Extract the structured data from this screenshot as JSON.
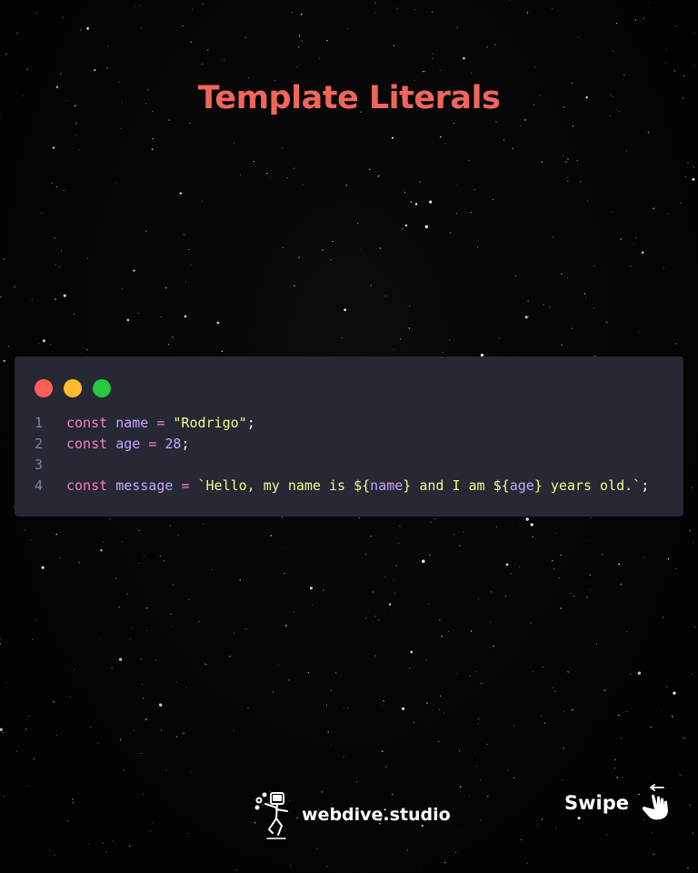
{
  "title": "Template Literals",
  "window": {
    "controls": [
      {
        "name": "close",
        "color": "#ff5f57"
      },
      {
        "name": "minimize",
        "color": "#febc2e"
      },
      {
        "name": "maximize",
        "color": "#28c840"
      }
    ]
  },
  "code": {
    "lines": [
      {
        "number": "1",
        "tokens": [
          {
            "t": "kw",
            "v": "const"
          },
          {
            "t": "punc",
            "v": " "
          },
          {
            "t": "var",
            "v": "name"
          },
          {
            "t": "punc",
            "v": " "
          },
          {
            "t": "op",
            "v": "="
          },
          {
            "t": "punc",
            "v": " "
          },
          {
            "t": "str",
            "v": "\"Rodrigo\""
          },
          {
            "t": "punc",
            "v": ";"
          }
        ]
      },
      {
        "number": "2",
        "tokens": [
          {
            "t": "kw",
            "v": "const"
          },
          {
            "t": "punc",
            "v": " "
          },
          {
            "t": "var",
            "v": "age"
          },
          {
            "t": "punc",
            "v": " "
          },
          {
            "t": "op",
            "v": "="
          },
          {
            "t": "punc",
            "v": " "
          },
          {
            "t": "num",
            "v": "28"
          },
          {
            "t": "punc",
            "v": ";"
          }
        ]
      },
      {
        "number": "3",
        "tokens": []
      },
      {
        "number": "4",
        "tokens": [
          {
            "t": "kw",
            "v": "const"
          },
          {
            "t": "punc",
            "v": " "
          },
          {
            "t": "var",
            "v": "message"
          },
          {
            "t": "punc",
            "v": " "
          },
          {
            "t": "op",
            "v": "="
          },
          {
            "t": "punc",
            "v": " "
          },
          {
            "t": "str",
            "v": "`Hello, my name is ${"
          },
          {
            "t": "var",
            "v": "name"
          },
          {
            "t": "str",
            "v": "} and I am ${"
          },
          {
            "t": "var",
            "v": "age"
          },
          {
            "t": "str",
            "v": "} years old.`"
          },
          {
            "t": "punc",
            "v": ";"
          }
        ]
      }
    ]
  },
  "footer": {
    "brand": "webdive.studio",
    "brand_icon": "astronaut-juggler-icon",
    "swipe_label": "Swipe",
    "swipe_icon": "swipe-hand-icon"
  }
}
